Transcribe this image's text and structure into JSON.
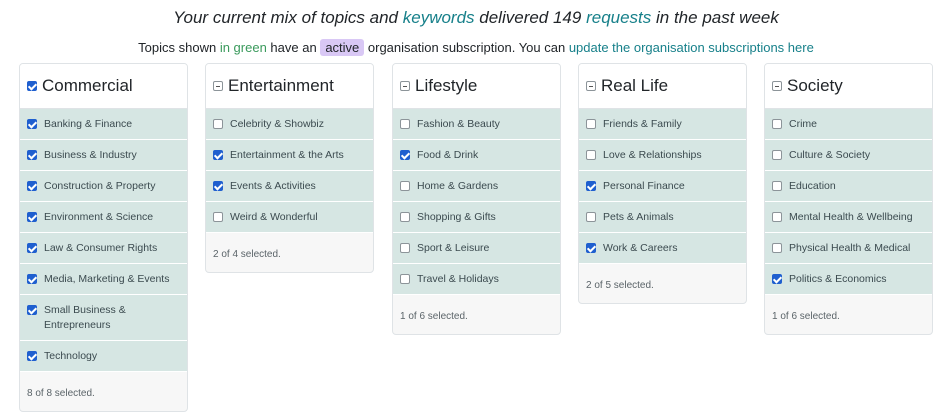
{
  "headline": {
    "prefix": "Your current mix of topics and ",
    "keywords_link": "keywords",
    "middle": " delivered 149 ",
    "requests_link": "requests",
    "suffix": " in the past week"
  },
  "subline": {
    "prefix": "Topics shown ",
    "green_text": "in green",
    "mid": " have an ",
    "active_badge": "active",
    "after": " organisation subscription. You can ",
    "link": "update the organisation subscriptions here"
  },
  "columns": [
    {
      "title": "Commercial",
      "header_state": "checked",
      "items": [
        {
          "label": "Banking & Finance",
          "checked": true
        },
        {
          "label": "Business & Industry",
          "checked": true
        },
        {
          "label": "Construction & Property",
          "checked": true
        },
        {
          "label": "Environment & Science",
          "checked": true
        },
        {
          "label": "Law & Consumer Rights",
          "checked": true
        },
        {
          "label": "Media, Marketing & Events",
          "checked": true
        },
        {
          "label": "Small Business & Entrepreneurs",
          "checked": true
        },
        {
          "label": "Technology",
          "checked": true
        }
      ],
      "footer": "8 of 8 selected."
    },
    {
      "title": "Entertainment",
      "header_state": "partial",
      "items": [
        {
          "label": "Celebrity & Showbiz",
          "checked": false
        },
        {
          "label": "Entertainment & the Arts",
          "checked": true
        },
        {
          "label": "Events & Activities",
          "checked": true
        },
        {
          "label": "Weird & Wonderful",
          "checked": false
        }
      ],
      "footer": "2 of 4 selected."
    },
    {
      "title": "Lifestyle",
      "header_state": "partial",
      "items": [
        {
          "label": "Fashion & Beauty",
          "checked": false
        },
        {
          "label": "Food & Drink",
          "checked": true
        },
        {
          "label": "Home & Gardens",
          "checked": false
        },
        {
          "label": "Shopping & Gifts",
          "checked": false
        },
        {
          "label": "Sport & Leisure",
          "checked": false
        },
        {
          "label": "Travel & Holidays",
          "checked": false
        }
      ],
      "footer": "1 of 6 selected."
    },
    {
      "title": "Real Life",
      "header_state": "partial",
      "items": [
        {
          "label": "Friends & Family",
          "checked": false
        },
        {
          "label": "Love & Relationships",
          "checked": false
        },
        {
          "label": "Personal Finance",
          "checked": true
        },
        {
          "label": "Pets & Animals",
          "checked": false
        },
        {
          "label": "Work & Careers",
          "checked": true
        }
      ],
      "footer": "2 of 5 selected."
    },
    {
      "title": "Society",
      "header_state": "partial",
      "items": [
        {
          "label": "Crime",
          "checked": false
        },
        {
          "label": "Culture & Society",
          "checked": false
        },
        {
          "label": "Education",
          "checked": false
        },
        {
          "label": "Mental Health & Wellbeing",
          "checked": false
        },
        {
          "label": "Physical Health & Medical",
          "checked": false
        },
        {
          "label": "Politics & Economics",
          "checked": true
        }
      ],
      "footer": "1 of 6 selected."
    }
  ]
}
